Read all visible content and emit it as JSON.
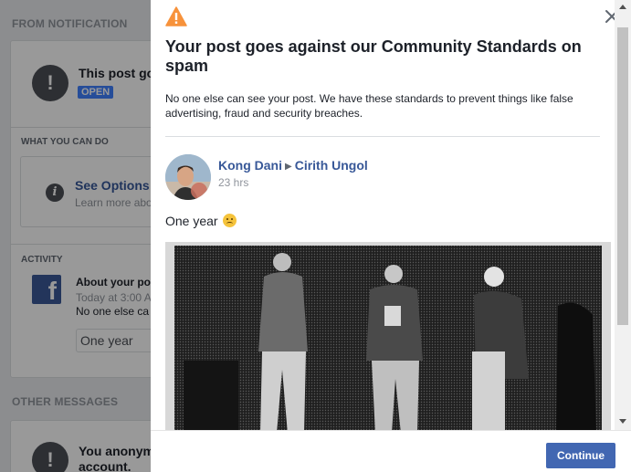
{
  "background": {
    "section_notification": "FROM NOTIFICATION",
    "notice_title": "This post go",
    "status_badge": "OPEN",
    "section_what_you_can_do": "WHAT YOU CAN DO",
    "see_options": "See Options",
    "learn_more": "Learn more abo",
    "section_activity": "ACTIVITY",
    "activity_title": "About your po",
    "activity_time": "Today at 3:00 A",
    "activity_note": "No one else ca",
    "activity_quote": "One year",
    "section_other_messages": "OTHER MESSAGES",
    "other_message_line1": "You anonym",
    "other_message_line2": "account."
  },
  "dialog": {
    "title": "Your post goes against our Community Standards on spam",
    "description": "No one else can see your post. We have these standards to prevent things like false advertising, fraud and security breaches.",
    "post": {
      "author": "Kong Dani",
      "destination": "Cirith Ungol",
      "time": "23 hrs",
      "text": "One year"
    },
    "continue_label": "Continue"
  },
  "colors": {
    "accent": "#4267b2",
    "link": "#385898",
    "warning": "#f7923b"
  },
  "icons": {
    "warning": "warning-triangle-icon",
    "close": "close-icon",
    "info": "info-icon",
    "facebook": "facebook-icon"
  }
}
